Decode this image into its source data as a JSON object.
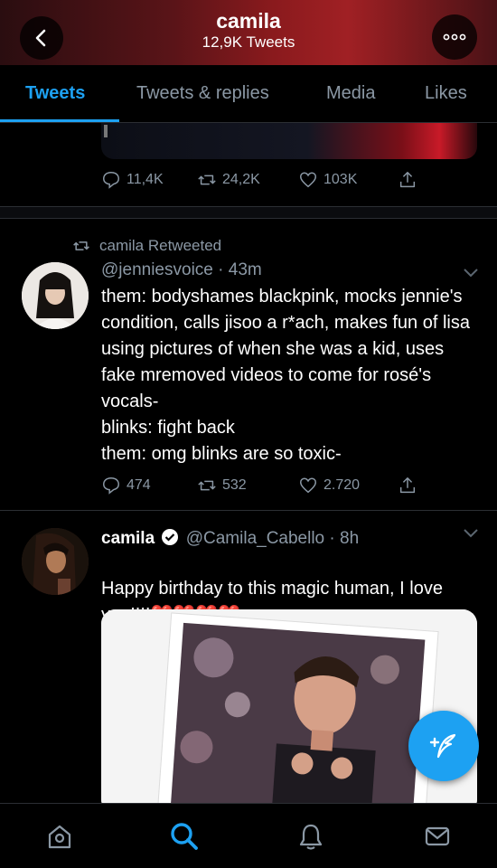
{
  "header": {
    "title": "camila",
    "subtitle": "12,9K Tweets"
  },
  "tabs": [
    {
      "label": "Tweets"
    },
    {
      "label": "Tweets & replies"
    },
    {
      "label": "Media"
    },
    {
      "label": "Likes"
    }
  ],
  "tweet1": {
    "replies": "11,4K",
    "retweets": "24,2K",
    "likes": "103K"
  },
  "tweet2": {
    "retweeted_by": "camila Retweeted",
    "handle": "@jenniesvoice",
    "time": "· 43m",
    "text": "them: bodyshames blackpink, mocks jennie's condition, calls jisoo a r*ach, makes fun of lisa using pictures of when she was a kid, uses fake mremoved videos to come for rosé's vocals-\nblinks: fight back\nthem: omg blinks are so toxic-",
    "replies": "474",
    "retweets": "532",
    "likes": "2.720"
  },
  "tweet3": {
    "name": "camila",
    "handle": "@Camila_Cabello",
    "time": "· 8h",
    "text": "Happy birthday to this magic human, I love you!!!!",
    "emoji": "❤️❤️❤️❤️"
  },
  "colors": {
    "accent": "#1da1f2",
    "muted": "#8b98a5",
    "verified": "#ffffff"
  },
  "icons": [
    "back-icon",
    "more-icon",
    "reply-icon",
    "retweet-icon",
    "like-icon",
    "share-icon",
    "chevron-down-icon",
    "verified-icon",
    "compose-icon",
    "home-icon",
    "search-icon",
    "notifications-icon",
    "messages-icon"
  ]
}
